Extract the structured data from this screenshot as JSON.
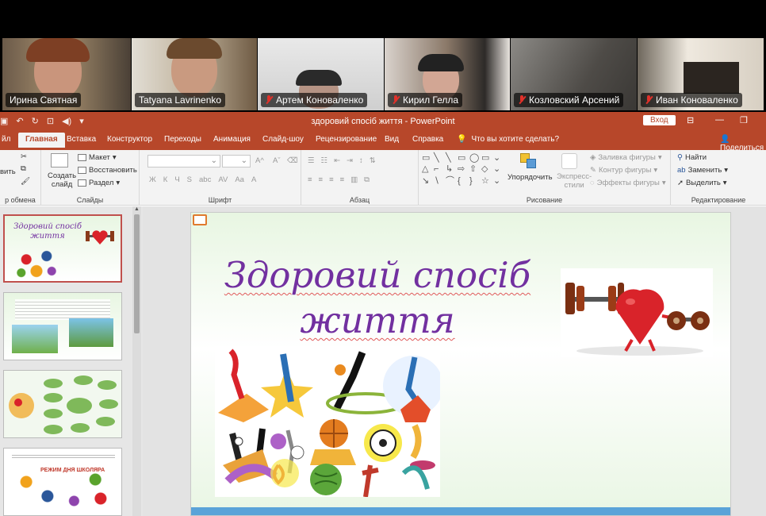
{
  "participants": [
    {
      "name": "Ирина Святная",
      "muted": false,
      "active": true
    },
    {
      "name": "Tatyana Lavrinenko",
      "muted": false,
      "active": false
    },
    {
      "name": "Артем Коноваленко",
      "muted": true,
      "active": false
    },
    {
      "name": "Кирил Гелла",
      "muted": true,
      "active": false
    },
    {
      "name": "Козловский Арсений",
      "muted": true,
      "active": false
    },
    {
      "name": "Иван Коноваленко",
      "muted": true,
      "active": false
    }
  ],
  "window": {
    "doc_title": "здоровий спосіб життя  -  PowerPoint",
    "login_label": "Вход"
  },
  "tabs": {
    "file": "йл",
    "home": "Главная",
    "insert": "Вставка",
    "design": "Конструктор",
    "transitions": "Переходы",
    "animation": "Анимация",
    "slideshow": "Слайд-шоу",
    "review": "Рецензирование",
    "view": "Вид",
    "help": "Справка",
    "tell_me": "Что вы хотите сделать?",
    "share": "Поделиться"
  },
  "ribbon": {
    "clipboard": {
      "paste": "вить",
      "label": "р обмена"
    },
    "slides": {
      "new_slide_line1": "Создать",
      "new_slide_line2": "слайд",
      "layout": "Макет",
      "reset": "Восстановить",
      "section": "Раздел",
      "label": "Слайды"
    },
    "font": {
      "bold": "Ж",
      "italic": "К",
      "underline": "Ч",
      "strike": "S",
      "spacing": "abc",
      "aa": "Aa",
      "color": "A",
      "label": "Шрифт"
    },
    "paragraph": {
      "label": "Абзац"
    },
    "drawing": {
      "arrange": "Упорядочить",
      "styles_line1": "Экспресс-",
      "styles_line2": "стили",
      "fill": "Заливка фигуры",
      "outline": "Контур фигуры",
      "effects": "Эффекты фигуры",
      "label": "Рисование"
    },
    "editing": {
      "find": "Найти",
      "replace": "Заменить",
      "select": "Выделить",
      "label": "Редактирование"
    }
  },
  "slide": {
    "title_line1": "Здоровий спосіб",
    "title_line2": "життя"
  },
  "thumbnails": {
    "slide1_title": "Здоровий спосіб життя",
    "slide4_banner": "РЕЖИМ ДНЯ ШКОЛЯРА"
  }
}
